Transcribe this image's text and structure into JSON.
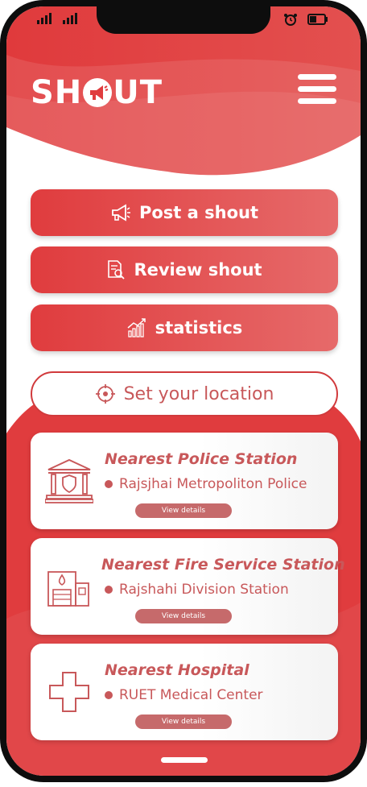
{
  "app": {
    "logo_text_left": "SH",
    "logo_text_right": "UT",
    "logo_full": "SHOUT"
  },
  "colors": {
    "primary": "#e03c3e",
    "primary_light": "#e66a6a",
    "text_accent": "#c8585a",
    "details_button": "#c66a6b"
  },
  "actions": [
    {
      "label": "Post a shout",
      "icon": "megaphone-icon"
    },
    {
      "label": "Review shout",
      "icon": "document-search-icon"
    },
    {
      "label": "statistics",
      "icon": "bar-chart-icon"
    }
  ],
  "location": {
    "label": "Set your location",
    "icon": "crosshair-icon"
  },
  "cards": [
    {
      "title": "Nearest Police Station",
      "subtitle": "Rajsjhai Metropoliton Police",
      "button": "View details",
      "icon": "police-building-icon"
    },
    {
      "title": "Nearest Fire Service Station",
      "subtitle": "Rajshahi Division Station",
      "button": "View details",
      "icon": "fire-station-icon"
    },
    {
      "title": "Nearest Hospital",
      "subtitle": "RUET Medical Center",
      "button": "View details",
      "icon": "medical-cross-icon"
    }
  ],
  "status_bar": {
    "left_icons": [
      "signal-icon",
      "signal-icon"
    ],
    "right_icons": [
      "alarm-icon",
      "battery-icon"
    ]
  }
}
